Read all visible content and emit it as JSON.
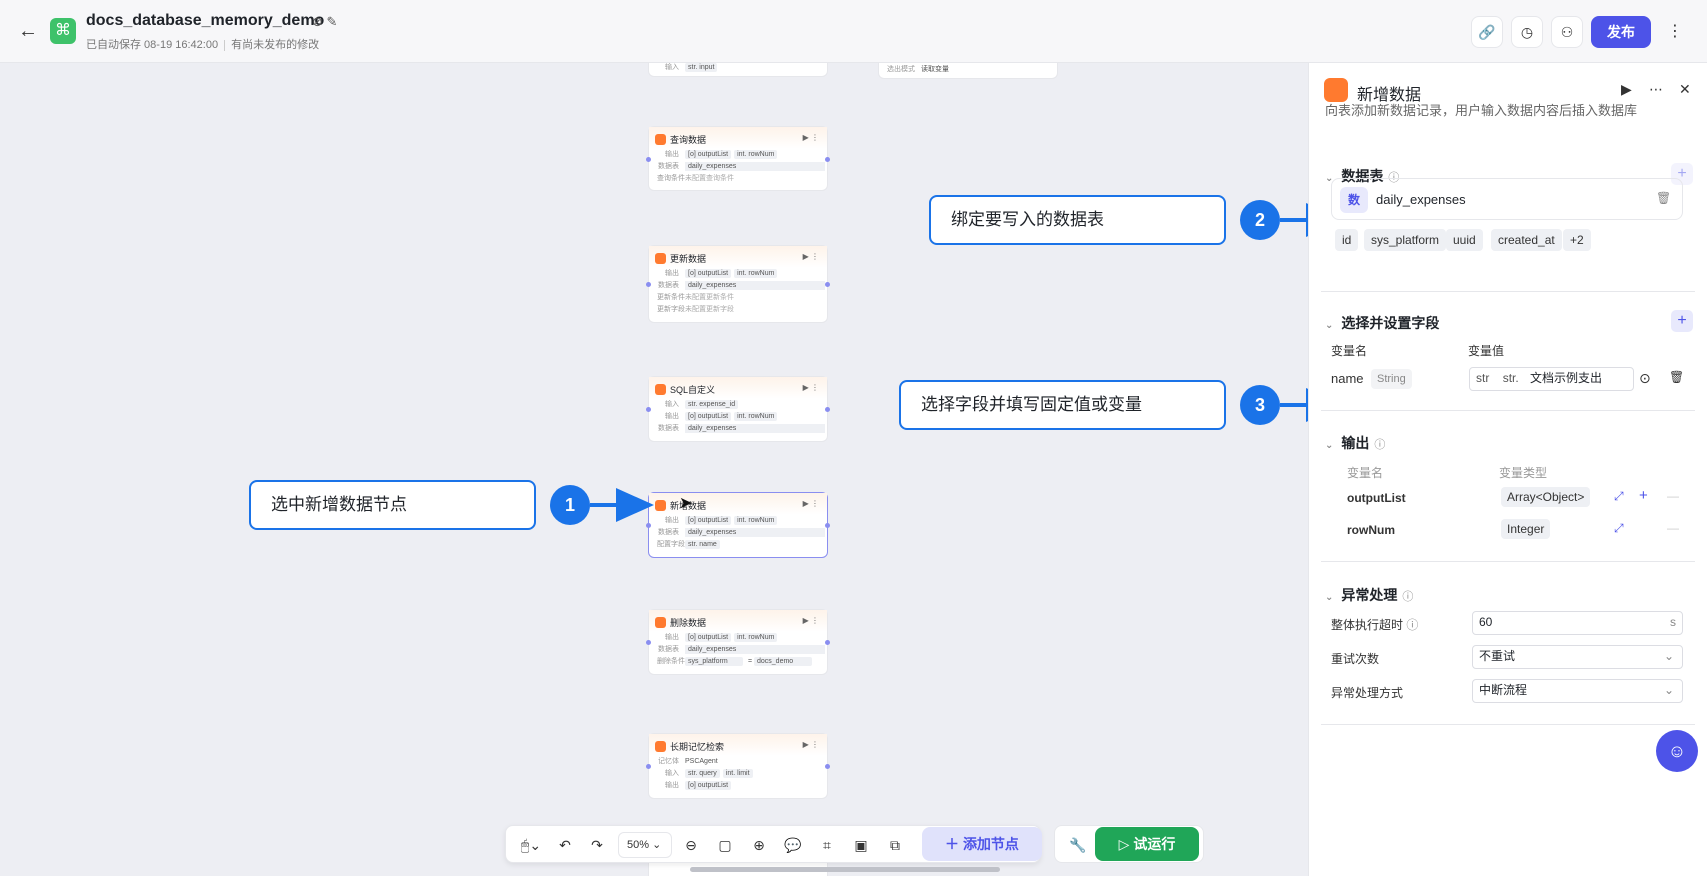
{
  "header": {
    "title": "docs_database_memory_demo",
    "autosave": "已自动保存 08-19 16:42:00",
    "unpublished": "有尚未发布的修改",
    "publish_label": "发布"
  },
  "canvas": {
    "node_top": {
      "rows": [
        "输入",
        "str. input"
      ],
      "side_label": "选出模式",
      "side_value": "读取变量"
    },
    "query": {
      "title": "查询数据",
      "out": "输出",
      "db": "数据表",
      "cond": "查询条件",
      "cond_value": "未配置查询条件",
      "outputList": "[o] outputList",
      "rowNum": "int. rowNum",
      "table": "daily_expenses"
    },
    "update": {
      "title": "更新数据",
      "out": "输出",
      "db": "数据表",
      "cond": "更新条件",
      "cond_value": "未配置更新条件",
      "field": "更新字段",
      "field_value": "未配置更新字段",
      "outputList": "[o] outputList",
      "rowNum": "int. rowNum",
      "table": "daily_expenses"
    },
    "sql": {
      "title": "SQL自定义",
      "in": "输入",
      "in_value": "str. expense_id",
      "out": "输出",
      "outputList": "[o] outputList",
      "rowNum": "int. rowNum",
      "db": "数据表",
      "table": "daily_expenses"
    },
    "insert": {
      "title": "新增数据",
      "out": "输出",
      "outputList": "[o] outputList",
      "rowNum": "int. rowNum",
      "db": "数据表",
      "table": "daily_expenses",
      "field": "配置字段",
      "field_value": "str. name"
    },
    "delete": {
      "title": "删除数据",
      "out": "输出",
      "outputList": "[o] outputList",
      "rowNum": "int. rowNum",
      "db": "数据表",
      "table": "daily_expenses",
      "cond": "删除条件",
      "cond_field": "sys_platform",
      "op": "=",
      "cond_value": "docs_demo"
    },
    "memory": {
      "title": "长期记忆检索",
      "agent_label": "记忆体",
      "agent": "PSCAgent",
      "in": "输入",
      "query": "str. query",
      "limit": "int. limit",
      "out": "输出",
      "outputList": "[o] outputList"
    },
    "zoom": "50%",
    "add_node": "添加节点",
    "test_run": "试运行"
  },
  "callouts": {
    "c1": "选中新增数据节点",
    "c2": "绑定要写入的数据表",
    "c3": "选择字段并填写固定值或变量",
    "b1": "1",
    "b2": "2",
    "b3": "3"
  },
  "panel": {
    "title": "新增数据",
    "desc": "向表添加新数据记录，用户输入数据内容后插入数据库",
    "table_section": "数据表",
    "table_badge": "数",
    "table_name": "daily_expenses",
    "tags": [
      "id",
      "sys_platform",
      "uuid",
      "created_at",
      "+2"
    ],
    "fields_section": "选择并设置字段",
    "col_name": "变量名",
    "col_value": "变量值",
    "field_name": "name",
    "field_type": "String",
    "val_type1": "str",
    "val_type2": "str.",
    "field_value": "文档示例支出",
    "output_section": "输出",
    "out_col_name": "变量名",
    "out_col_type": "变量类型",
    "outputs": [
      {
        "name": "outputList",
        "type": "Array<Object>"
      },
      {
        "name": "rowNum",
        "type": "Integer"
      }
    ],
    "error_section": "异常处理",
    "timeout_label": "整体执行超时",
    "timeout_value": "60",
    "timeout_unit": "s",
    "retry_label": "重试次数",
    "retry_value": "不重试",
    "mode_label": "异常处理方式",
    "mode_value": "中断流程"
  },
  "colors": {
    "accent": "#4d53e8",
    "callout_blue": "#1a73e8",
    "run_green": "#20a658",
    "node_orange": "#ff7a2f"
  }
}
